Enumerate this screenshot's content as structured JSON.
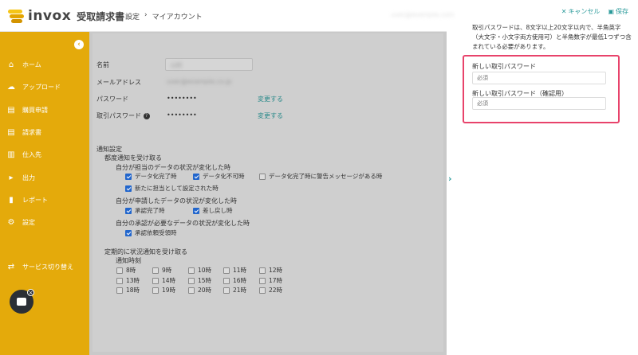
{
  "header": {
    "logo_text": "invox",
    "logo_sub": "受取請求書",
    "breadcrumb": [
      "設定",
      "›",
      "マイアカウント"
    ],
    "user_name": "user@example.com"
  },
  "sidebar": {
    "collapse_glyph": "‹",
    "items": [
      {
        "label": "ホーム",
        "icon": "home-icon",
        "glyph": "⌂"
      },
      {
        "label": "アップロード",
        "icon": "cloud-upload-icon",
        "glyph": "☁"
      },
      {
        "label": "購買申請",
        "icon": "document-icon",
        "glyph": "▤"
      },
      {
        "label": "請求書",
        "icon": "invoice-icon",
        "glyph": "▤"
      },
      {
        "label": "仕入先",
        "icon": "building-icon",
        "glyph": "▥"
      },
      {
        "label": "出力",
        "icon": "export-icon",
        "glyph": "▸"
      },
      {
        "label": "レポート",
        "icon": "chart-icon",
        "glyph": "▮"
      },
      {
        "label": "設定",
        "icon": "gear-icon",
        "glyph": "⚙"
      },
      {
        "label": "サービス切り替え",
        "icon": "switch-icon",
        "glyph": "⇄"
      }
    ],
    "chat_close": "×"
  },
  "account": {
    "name_label": "名前",
    "name_value": "山田",
    "email_label": "メールアドレス",
    "email_value": "user@example.co.jp",
    "password_label": "パスワード",
    "password_value": "••••••••",
    "password_link": "変更する",
    "trade_password_label": "取引パスワード",
    "trade_password_help": "?",
    "trade_password_value": "••••••••",
    "trade_password_link": "変更する"
  },
  "notifications": {
    "title": "通知設定",
    "each_time": "都度通知を受け取る",
    "group1_title": "自分が担当のデータの状況が変化した時",
    "group1_options": [
      {
        "label": "データ化完了時",
        "checked": true
      },
      {
        "label": "データ化不可時",
        "checked": true
      },
      {
        "label": "データ化完了時に警告メッセージがある時",
        "checked": false
      },
      {
        "label": "新たに担当として設定された時",
        "checked": true
      }
    ],
    "group2_title": "自分が申請したデータの状況が変化した時",
    "group2_options": [
      {
        "label": "承認完了時",
        "checked": true
      },
      {
        "label": "差し戻し時",
        "checked": true
      }
    ],
    "group3_title": "自分の承認が必要なデータの状況が変化した時",
    "group3_options": [
      {
        "label": "承認依頼受領時",
        "checked": true
      }
    ],
    "periodic_title": "定期的に状況通知を受け取る",
    "time_label": "通知時刻",
    "hours": [
      "8時",
      "9時",
      "10時",
      "11時",
      "12時",
      "13時",
      "14時",
      "15時",
      "16時",
      "17時",
      "18時",
      "19時",
      "20時",
      "21時",
      "22時"
    ]
  },
  "expand_glyph": "›",
  "panel": {
    "cancel_label": "キャンセル",
    "cancel_glyph": "✕",
    "save_label": "保存",
    "save_glyph": "▣",
    "description": "取引パスワードは、8文字以上20文字以内で、半角英字（大文字・小文字両方使用可）と半角数字が最低1つずつ含まれている必要があります。",
    "new_password_label": "新しい取引パスワード",
    "new_password_placeholder": "必須",
    "confirm_password_label": "新しい取引パスワード（確認用）",
    "confirm_password_placeholder": "必須"
  },
  "colors": {
    "sidebar": "#e4aa0b",
    "accent": "#2a9a9a",
    "highlight": "#e8436b",
    "checkbox": "#2266cc"
  }
}
